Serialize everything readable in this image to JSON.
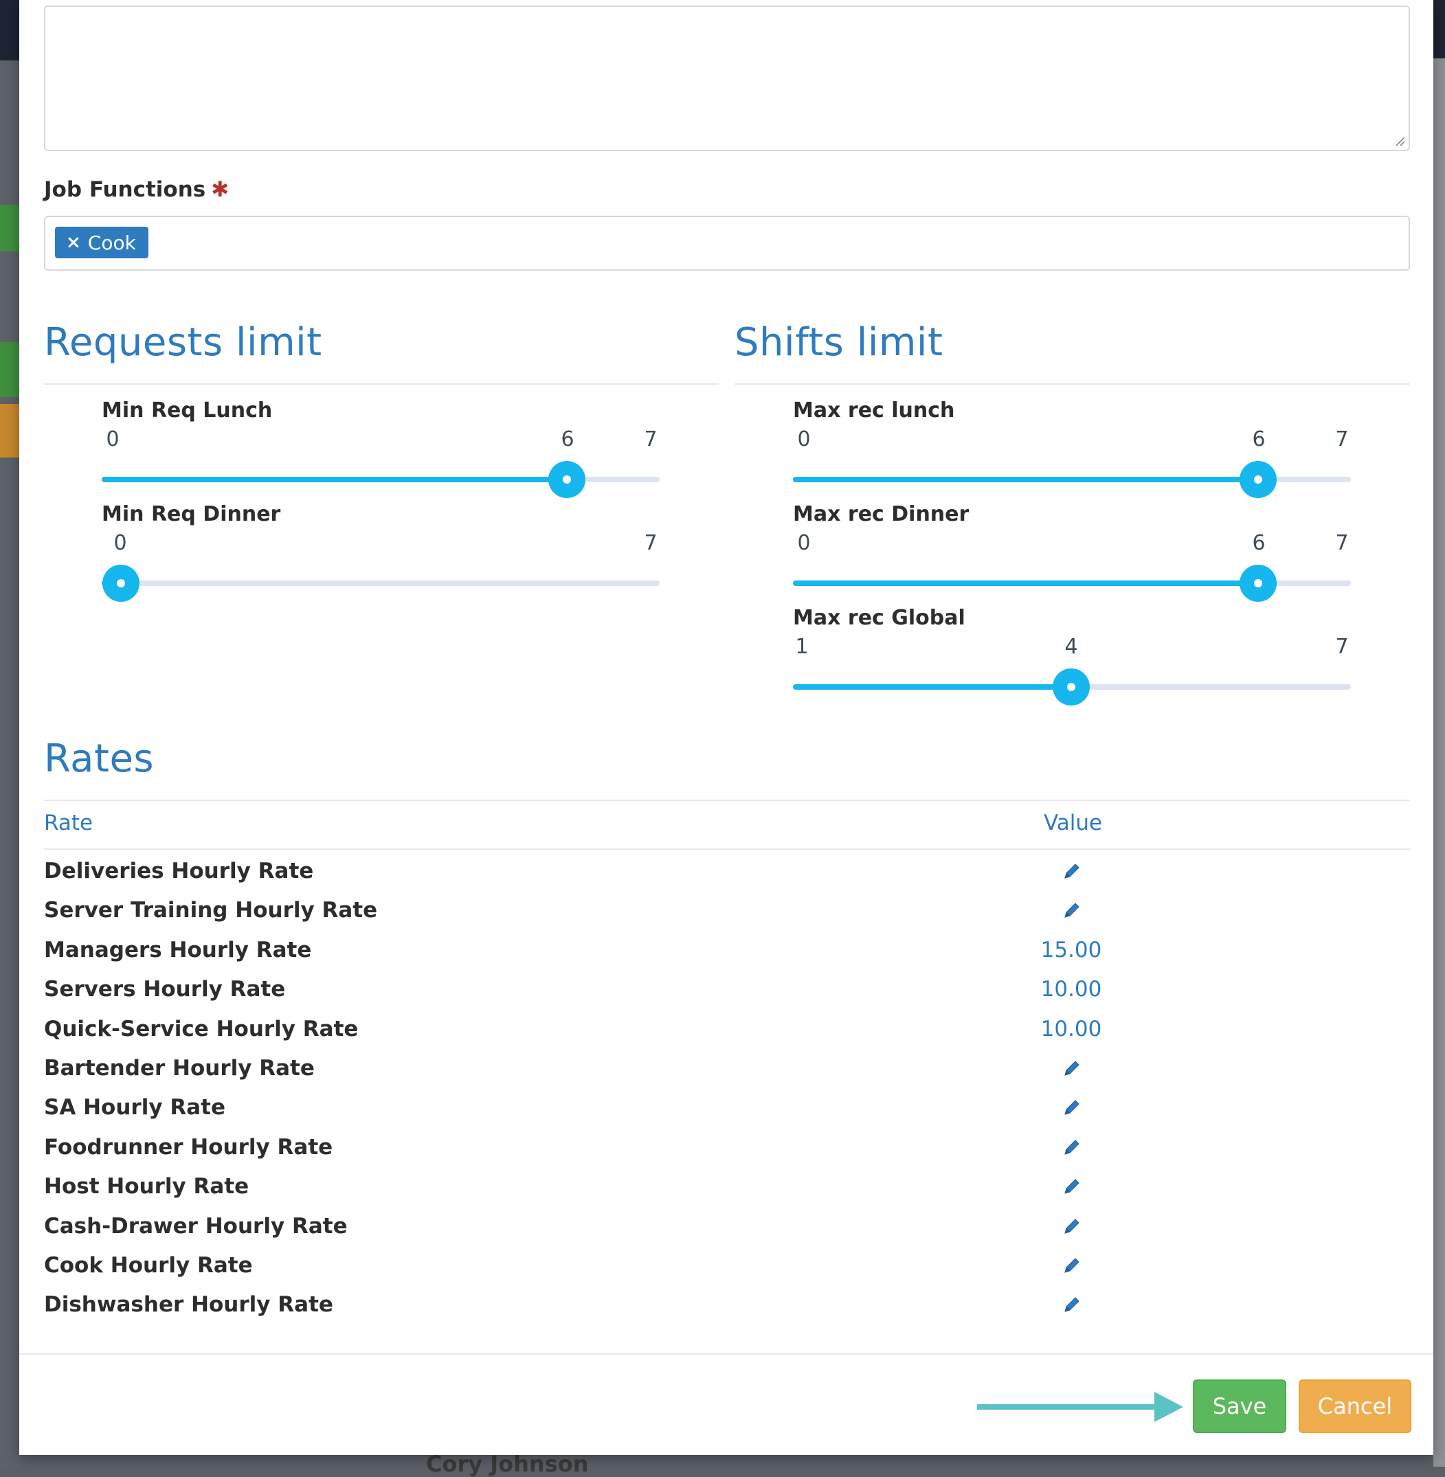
{
  "form": {
    "job_functions_label": "Job Functions",
    "required_mark": "✱",
    "tags": [
      {
        "label": "Cook",
        "remove_icon": "×"
      }
    ]
  },
  "requests_limit": {
    "title": "Requests limit",
    "sliders": [
      {
        "label": "Min Req Lunch",
        "min": "0",
        "max": "7",
        "value": "6",
        "value_num": 6
      },
      {
        "label": "Min Req Dinner",
        "min": "0",
        "max": "7",
        "value": "0",
        "value_num": 0
      }
    ]
  },
  "shifts_limit": {
    "title": "Shifts limit",
    "sliders": [
      {
        "label": "Max rec lunch",
        "min": "0",
        "max": "7",
        "value": "6",
        "value_num": 6
      },
      {
        "label": "Max rec Dinner",
        "min": "0",
        "max": "7",
        "value": "6",
        "value_num": 6
      },
      {
        "label": "Max rec Global",
        "min": "1",
        "max": "7",
        "value": "4",
        "value_num": 4
      }
    ]
  },
  "rates": {
    "title": "Rates",
    "columns": {
      "rate": "Rate",
      "value": "Value"
    },
    "rows": [
      {
        "name": "Deliveries Hourly Rate",
        "value": ""
      },
      {
        "name": "Server Training Hourly Rate",
        "value": ""
      },
      {
        "name": "Managers Hourly Rate",
        "value": "15.00"
      },
      {
        "name": "Servers Hourly Rate",
        "value": "10.00"
      },
      {
        "name": "Quick-Service Hourly Rate",
        "value": "10.00"
      },
      {
        "name": "Bartender Hourly Rate",
        "value": ""
      },
      {
        "name": "SA Hourly Rate",
        "value": ""
      },
      {
        "name": "Foodrunner Hourly Rate",
        "value": ""
      },
      {
        "name": "Host Hourly Rate",
        "value": ""
      },
      {
        "name": "Cash-Drawer Hourly Rate",
        "value": ""
      },
      {
        "name": "Cook Hourly Rate",
        "value": ""
      },
      {
        "name": "Dishwasher Hourly Rate",
        "value": ""
      }
    ],
    "empty_value_icon": "pencil-icon"
  },
  "footer": {
    "save_label": "Save",
    "cancel_label": "Cancel"
  },
  "underlay": {
    "name": "Cory Johnson"
  },
  "colors": {
    "accent_blue": "#2e7bc0",
    "slider_blue": "#16b6ef",
    "save_green": "#5cb85c",
    "cancel_orange": "#f0ad4e",
    "arrow_teal": "#5bc3c3",
    "required_red": "#b8322b"
  }
}
